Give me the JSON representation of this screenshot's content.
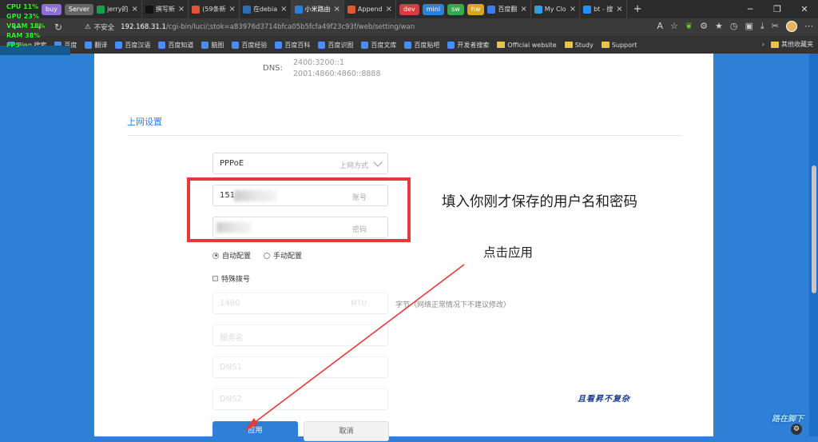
{
  "hud": {
    "cpu": "CPU 11%",
    "gpu": "GPU 23%",
    "vram": "VRAM 18%",
    "ram": "RAM 38%",
    "fps": "FPS --"
  },
  "tabs": {
    "groups": [
      {
        "label": "buy",
        "color": "#8c6fd0"
      },
      {
        "label": "Server",
        "color": "#666"
      }
    ],
    "items": [
      {
        "label": "jerry的",
        "icon": "leaf-icon",
        "color": "#1a9e4b"
      },
      {
        "label": "撰写新",
        "icon": "tiktok-icon",
        "color": "#111"
      },
      {
        "label": "(59条新",
        "icon": "c-icon",
        "color": "#e1533b"
      },
      {
        "label": "在debia",
        "icon": "wordpress-icon",
        "color": "#2b6fb7"
      },
      {
        "label": "小米路由",
        "icon": "wifi-icon",
        "color": "#2e7fd6",
        "active": true
      },
      {
        "label": "Append",
        "icon": "grid-icon",
        "color": "#e05b2c"
      },
      {
        "label": "dev",
        "group": true,
        "color": "#d04040"
      },
      {
        "label": "mini",
        "group": true,
        "color": "#2e7fd6"
      },
      {
        "label": "sw",
        "group": true,
        "color": "#38a84e"
      },
      {
        "label": "hw",
        "group": true,
        "color": "#d9a521"
      },
      {
        "label": "百度翻",
        "icon": "translate-icon",
        "color": "#3b7ef0"
      },
      {
        "label": "My Clo",
        "icon": "cloud-icon",
        "color": "#2ea0e0"
      },
      {
        "label": "bt - 搜",
        "icon": "bing-icon",
        "color": "#258ffa"
      }
    ]
  },
  "address": {
    "insecure": "不安全",
    "host": "192.168.31.1",
    "path": "/cgi-bin/luci/;stok=a83976d3714bfca05b5fcfa49f23c93f/web/setting/wan"
  },
  "bookmarks": {
    "items": [
      "Bing 搜索",
      "百度",
      "翻译",
      "百度汉语",
      "百度知道",
      "脑图",
      "百度经验",
      "百度百科",
      "百度识图",
      "百度文库",
      "百度贴吧",
      "开发者搜索",
      "Official website",
      "Study",
      "Support"
    ],
    "right": "其他收藏夹"
  },
  "page": {
    "dns_label": "DNS:",
    "dns1": "2400:3200::1",
    "dns2": "2001:4860:4860::8888",
    "section_title": "上网设置",
    "wan_type": {
      "value": "PPPoE",
      "hint": "上网方式"
    },
    "account": {
      "value": "151",
      "hint": "账号"
    },
    "password": {
      "hint": "密码"
    },
    "auto_config": "自动配置",
    "manual_config": "手动配置",
    "special_dial": "特殊拨号",
    "mtu": {
      "value": "1480",
      "hint": "MTU"
    },
    "mtu_note": "字节（网络正常情况下不建议修改）",
    "service_name": "服务名",
    "dns1_ph": "DNS1",
    "dns2_ph": "DNS2",
    "apply": "应用",
    "cancel": "取消"
  },
  "annotations": {
    "note1": "填入你刚才保存的用户名和密码",
    "note2": "点击应用",
    "signature": "且看昇不复杂",
    "watermark": "路在脚下"
  }
}
